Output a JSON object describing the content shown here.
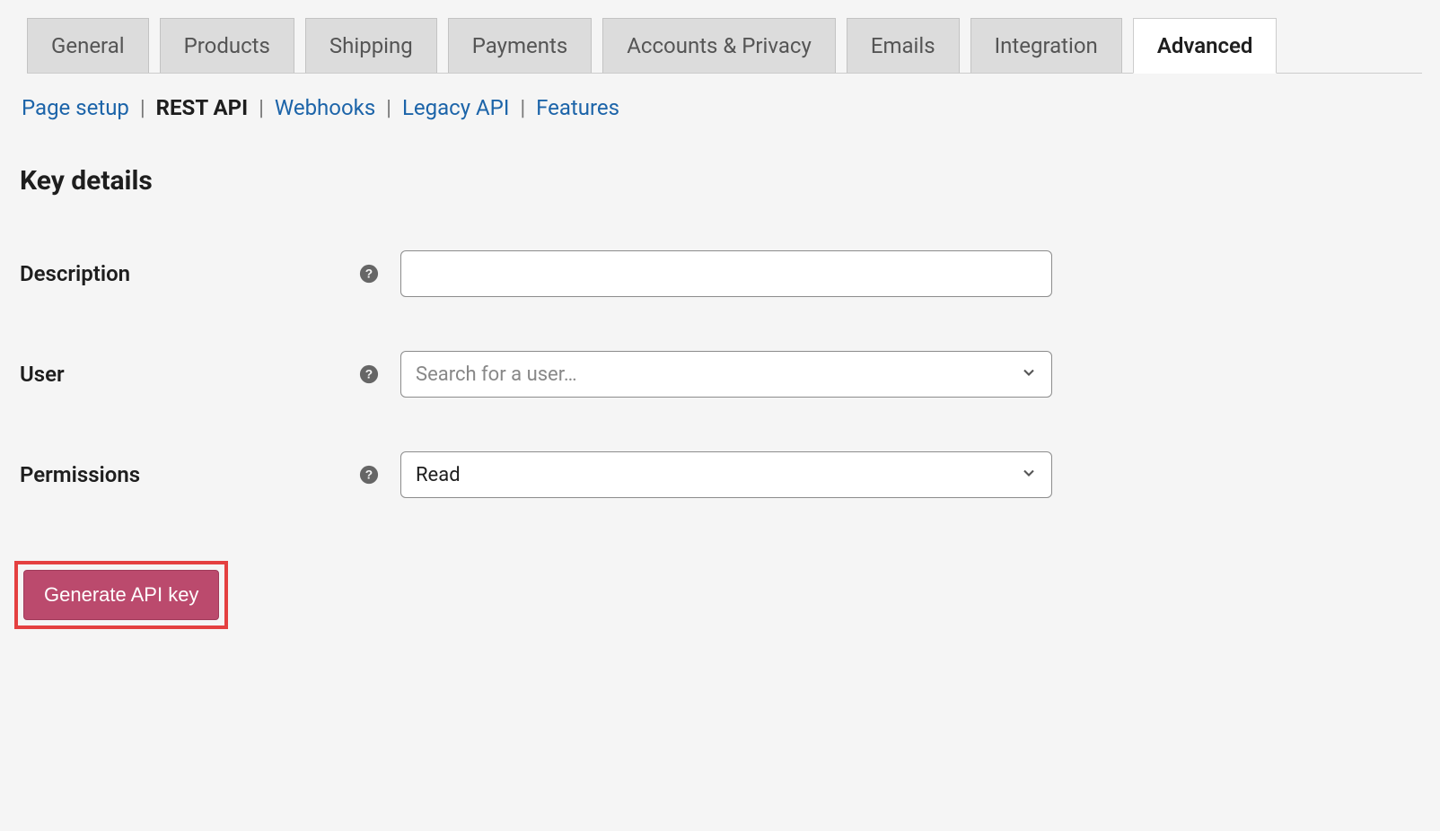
{
  "tabs": [
    {
      "label": "General"
    },
    {
      "label": "Products"
    },
    {
      "label": "Shipping"
    },
    {
      "label": "Payments"
    },
    {
      "label": "Accounts & Privacy"
    },
    {
      "label": "Emails"
    },
    {
      "label": "Integration"
    },
    {
      "label": "Advanced"
    }
  ],
  "subnav": [
    {
      "label": "Page setup"
    },
    {
      "label": "REST API"
    },
    {
      "label": "Webhooks"
    },
    {
      "label": "Legacy API"
    },
    {
      "label": "Features"
    }
  ],
  "page_title": "Key details",
  "form": {
    "description": {
      "label": "Description",
      "value": ""
    },
    "user": {
      "label": "User",
      "placeholder": "Search for a user…",
      "value": ""
    },
    "permissions": {
      "label": "Permissions",
      "value": "Read"
    }
  },
  "button_label": "Generate API key"
}
